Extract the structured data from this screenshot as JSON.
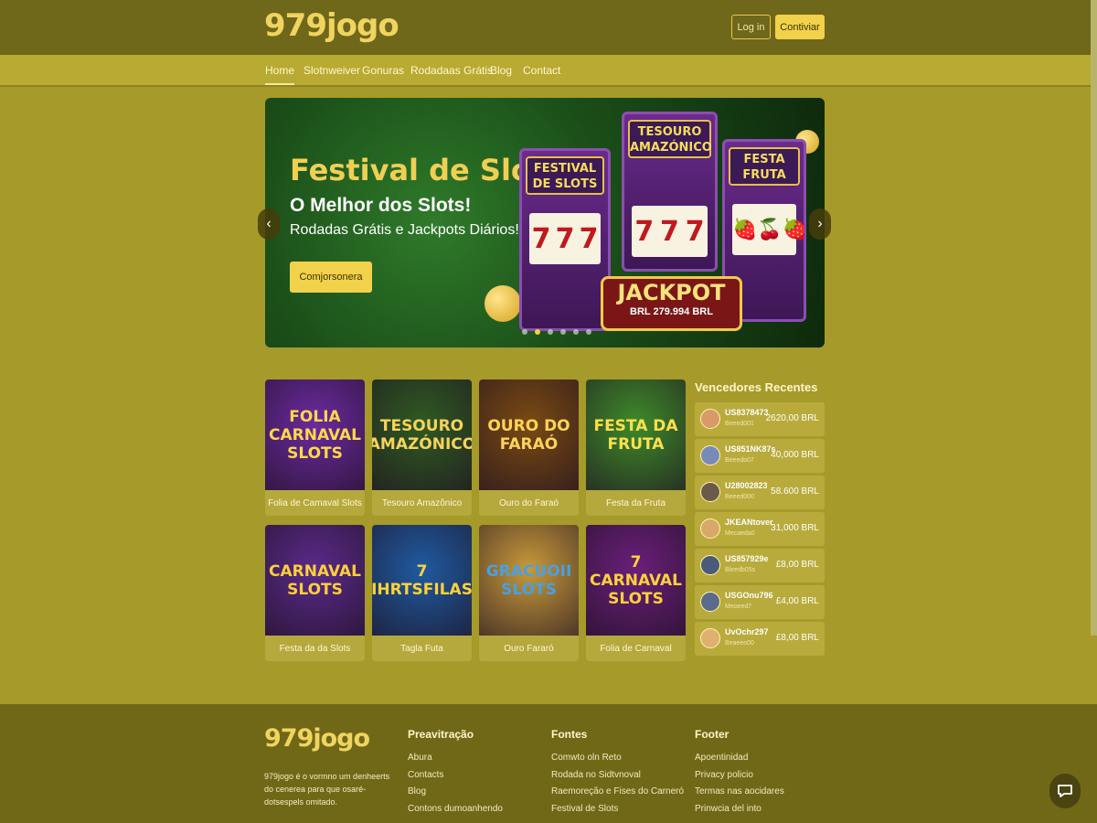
{
  "header": {
    "logo": "979jogo",
    "login_label": "Log in",
    "register_label": "Contiviar"
  },
  "nav": {
    "items": [
      {
        "label": "Home",
        "active": true
      },
      {
        "label": "Slotnweiver"
      },
      {
        "label": "Gonuras"
      },
      {
        "label": "Rodadaas Grátis"
      },
      {
        "label": "Blog"
      },
      {
        "label": "Contact"
      }
    ]
  },
  "hero": {
    "title": "Festival de Slots",
    "subtitle": "O Melhor dos Slots!",
    "subtitle2": "Rodadas Grátis e Jackpots Diários!",
    "cta_label": "Comjorsonera",
    "machines": [
      {
        "sign": "FESTIVAL DE SLOTS",
        "reels": [
          "7",
          "7",
          "7"
        ]
      },
      {
        "sign": "TESOURO AMAZÓNICO",
        "reels": [
          "7",
          "7",
          "7"
        ]
      },
      {
        "sign": "FESTA FRUTA",
        "reels": [
          "🍓",
          "🍒",
          "🍓"
        ]
      }
    ],
    "jackpot_title": "JACKPOT",
    "jackpot_amount": "BRL 279.994 BRL",
    "slides": 6,
    "active_slide": 1,
    "prev_arrow": "‹",
    "next_arrow": "›"
  },
  "games": [
    {
      "art": "FOLIA CARNAVAL SLOTS",
      "name": "Folia de Camaval Slots",
      "bg": "#6b2aa0",
      "fg": "#ffd84a"
    },
    {
      "art": "TESOURO AMAZÓNICO",
      "name": "Tesouro Amazônico",
      "bg": "#2f5a22",
      "fg": "#f6d35a"
    },
    {
      "art": "OURO DO FARAÓ",
      "name": "Ouro do Faraó",
      "bg": "#7a4a12",
      "fg": "#ffd45a"
    },
    {
      "art": "FESTA DA FRUTA",
      "name": "Festa da Fruta",
      "bg": "#3e8a2a",
      "fg": "#ffe04a"
    },
    {
      "art": "CARNAVAL SLOTS",
      "name": "Festa da da Slots",
      "bg": "#5a2a8a",
      "fg": "#ffcf3a"
    },
    {
      "art": "7 IHRTSFILAS",
      "name": "Tagla Futa",
      "bg": "#1f5aa0",
      "fg": "#ffd23a"
    },
    {
      "art": "GRACUOII SLOTS",
      "name": "Ouro Fararó",
      "bg": "#c89a3a",
      "fg": "#4aa0e0"
    },
    {
      "art": "7 CARNAVAL SLOTS",
      "name": "Folia de Carnaval",
      "bg": "#6a1f7a",
      "fg": "#ffd23a"
    }
  ],
  "winners": {
    "title": "Vencedores Recentes",
    "rows": [
      {
        "user": "US8378473",
        "meta": "Beeed001",
        "amount": "2620,00 BRL",
        "avatar": "#d89a6a"
      },
      {
        "user": "US851NK87s",
        "meta": "Beeedo07",
        "amount": "40,000 BRL",
        "avatar": "#7a8ab8"
      },
      {
        "user": "U28002823",
        "meta": "Beeed000",
        "amount": "58.600 BRL",
        "avatar": "#6a5a4a"
      },
      {
        "user": "JKEANtover",
        "meta": "Mecaeda0",
        "amount": "31,000 BRL",
        "avatar": "#d8a86a"
      },
      {
        "user": "US857929e",
        "meta": "Bleedb05s",
        "amount": "£8,00 BRL",
        "avatar": "#4a5a7a"
      },
      {
        "user": "USGOnu796",
        "meta": "Meoeed7",
        "amount": "£4,00 BRL",
        "avatar": "#5a6a8a"
      },
      {
        "user": "UvOchr297",
        "meta": "Beaeeo00",
        "amount": "£8,00 BRL",
        "avatar": "#e0b070"
      }
    ]
  },
  "footer": {
    "logo": "979jogo",
    "description": "979jogo é o vormno um denheerts do cenerea para que osaré-dotsespels omitado.",
    "columns": [
      {
        "title": "Preavitração",
        "links": [
          "Abura",
          "Contacts",
          "Blog",
          "Contons dumoanhendo"
        ]
      },
      {
        "title": "Fontes",
        "links": [
          "Comwto oln Reto",
          "Rodada no Sidtvnoval",
          "Raemoreção e Fises do Carneró",
          "Festival de Slots"
        ]
      },
      {
        "title": "Footer",
        "links": [
          "Apoentinidad",
          "Privacy policio",
          "Termas nas aocidares",
          "Prinwcia del into"
        ]
      }
    ]
  },
  "colors": {
    "background": "#a59a2a",
    "topbar": "#6f671a",
    "accent": "#f2d24a",
    "footer": "#706817"
  },
  "icons": {
    "chat": "chat-bubble-icon"
  }
}
